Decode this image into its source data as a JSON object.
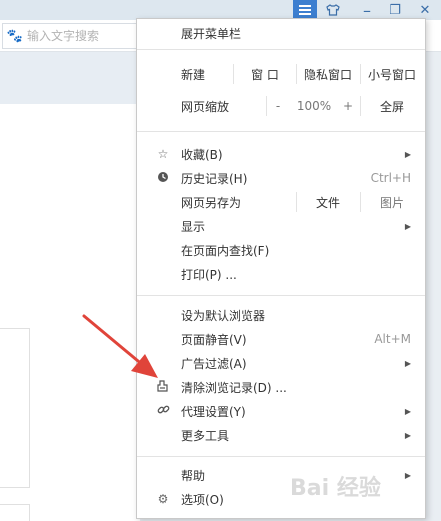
{
  "titlebar": {
    "menu_icon": "hamburger-icon",
    "skin_icon": "shirt-icon",
    "minimize": "–",
    "maximize": "❐",
    "close": "✕"
  },
  "search": {
    "placeholder": "输入文字搜索",
    "icon": "paw-icon"
  },
  "menu": {
    "expand_menubar": "展开菜单栏",
    "new_label": "新建",
    "new_window": "窗 口",
    "new_private": "隐私窗口",
    "new_small": "小号窗口",
    "zoom_label": "网页缩放",
    "zoom_minus": "-",
    "zoom_value": "100%",
    "zoom_plus": "+",
    "fullscreen": "全屏",
    "favorites": "收藏(B)",
    "history": "历史记录(H)",
    "history_shortcut": "Ctrl+H",
    "save_as": "网页另存为",
    "save_file": "文件",
    "save_image": "图片",
    "display": "显示",
    "find": "在页面内查找(F)",
    "print": "打印(P) ...",
    "set_default": "设为默认浏览器",
    "mute": "页面静音(V)",
    "mute_shortcut": "Alt+M",
    "adblock": "广告过滤(A)",
    "clear_history": "清除浏览记录(D) ...",
    "proxy": "代理设置(Y)",
    "more_tools": "更多工具",
    "help": "帮助",
    "options": "选项(O)"
  },
  "watermark": "Bai 经验",
  "colors": {
    "accent": "#3d7fd0",
    "arrow": "#e0443a"
  }
}
